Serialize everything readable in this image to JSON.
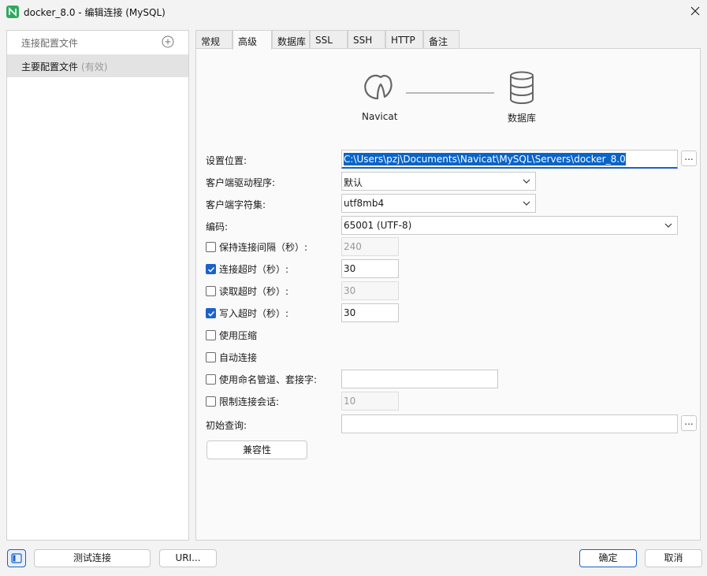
{
  "window": {
    "title": "docker_8.0 - 编辑连接 (MySQL)"
  },
  "left_panel": {
    "header_label": "连接配置文件",
    "items": [
      {
        "label": "主要配置文件",
        "badge": "(有效)"
      }
    ]
  },
  "tabs": [
    {
      "label": "常规",
      "active": false
    },
    {
      "label": "高级",
      "active": true
    },
    {
      "label": "数据库",
      "active": false
    },
    {
      "label": "SSL",
      "active": false
    },
    {
      "label": "SSH",
      "active": false
    },
    {
      "label": "HTTP",
      "active": false
    },
    {
      "label": "备注",
      "active": false
    }
  ],
  "diagram": {
    "left_label": "Navicat",
    "right_label": "数据库"
  },
  "form": {
    "settings_location": {
      "label": "设置位置:",
      "value": "C:\\Users\\pzj\\Documents\\Navicat\\MySQL\\Servers\\docker_8.0",
      "button": "..."
    },
    "client_driver": {
      "label": "客户端驱动程序:",
      "value": "默认"
    },
    "client_charset": {
      "label": "客户端字符集:",
      "value": "utf8mb4"
    },
    "encoding": {
      "label": "编码:",
      "value": "65001 (UTF-8)"
    },
    "keepalive": {
      "label": "保持连接间隔（秒）:",
      "checked": false,
      "value": "240"
    },
    "connect_timeout": {
      "label": "连接超时（秒）:",
      "checked": true,
      "value": "30"
    },
    "read_timeout": {
      "label": "读取超时（秒）:",
      "checked": false,
      "value": "30"
    },
    "write_timeout": {
      "label": "写入超时（秒）:",
      "checked": true,
      "value": "30"
    },
    "use_compression": {
      "label": "使用压缩",
      "checked": false
    },
    "auto_connect": {
      "label": "自动连接",
      "checked": false
    },
    "named_pipe": {
      "label": "使用命名管道、套接字:",
      "checked": false,
      "value": ""
    },
    "limit_sessions": {
      "label": "限制连接会话:",
      "checked": false,
      "value": "10"
    },
    "init_query": {
      "label": "初始查询:",
      "value": "",
      "button": "..."
    },
    "compat_button": "兼容性"
  },
  "footer": {
    "test_connection": "测试连接",
    "uri": "URI...",
    "ok": "确定",
    "cancel": "取消"
  },
  "colors": {
    "accent": "#1a62c9",
    "selection": "#0a64c8"
  }
}
